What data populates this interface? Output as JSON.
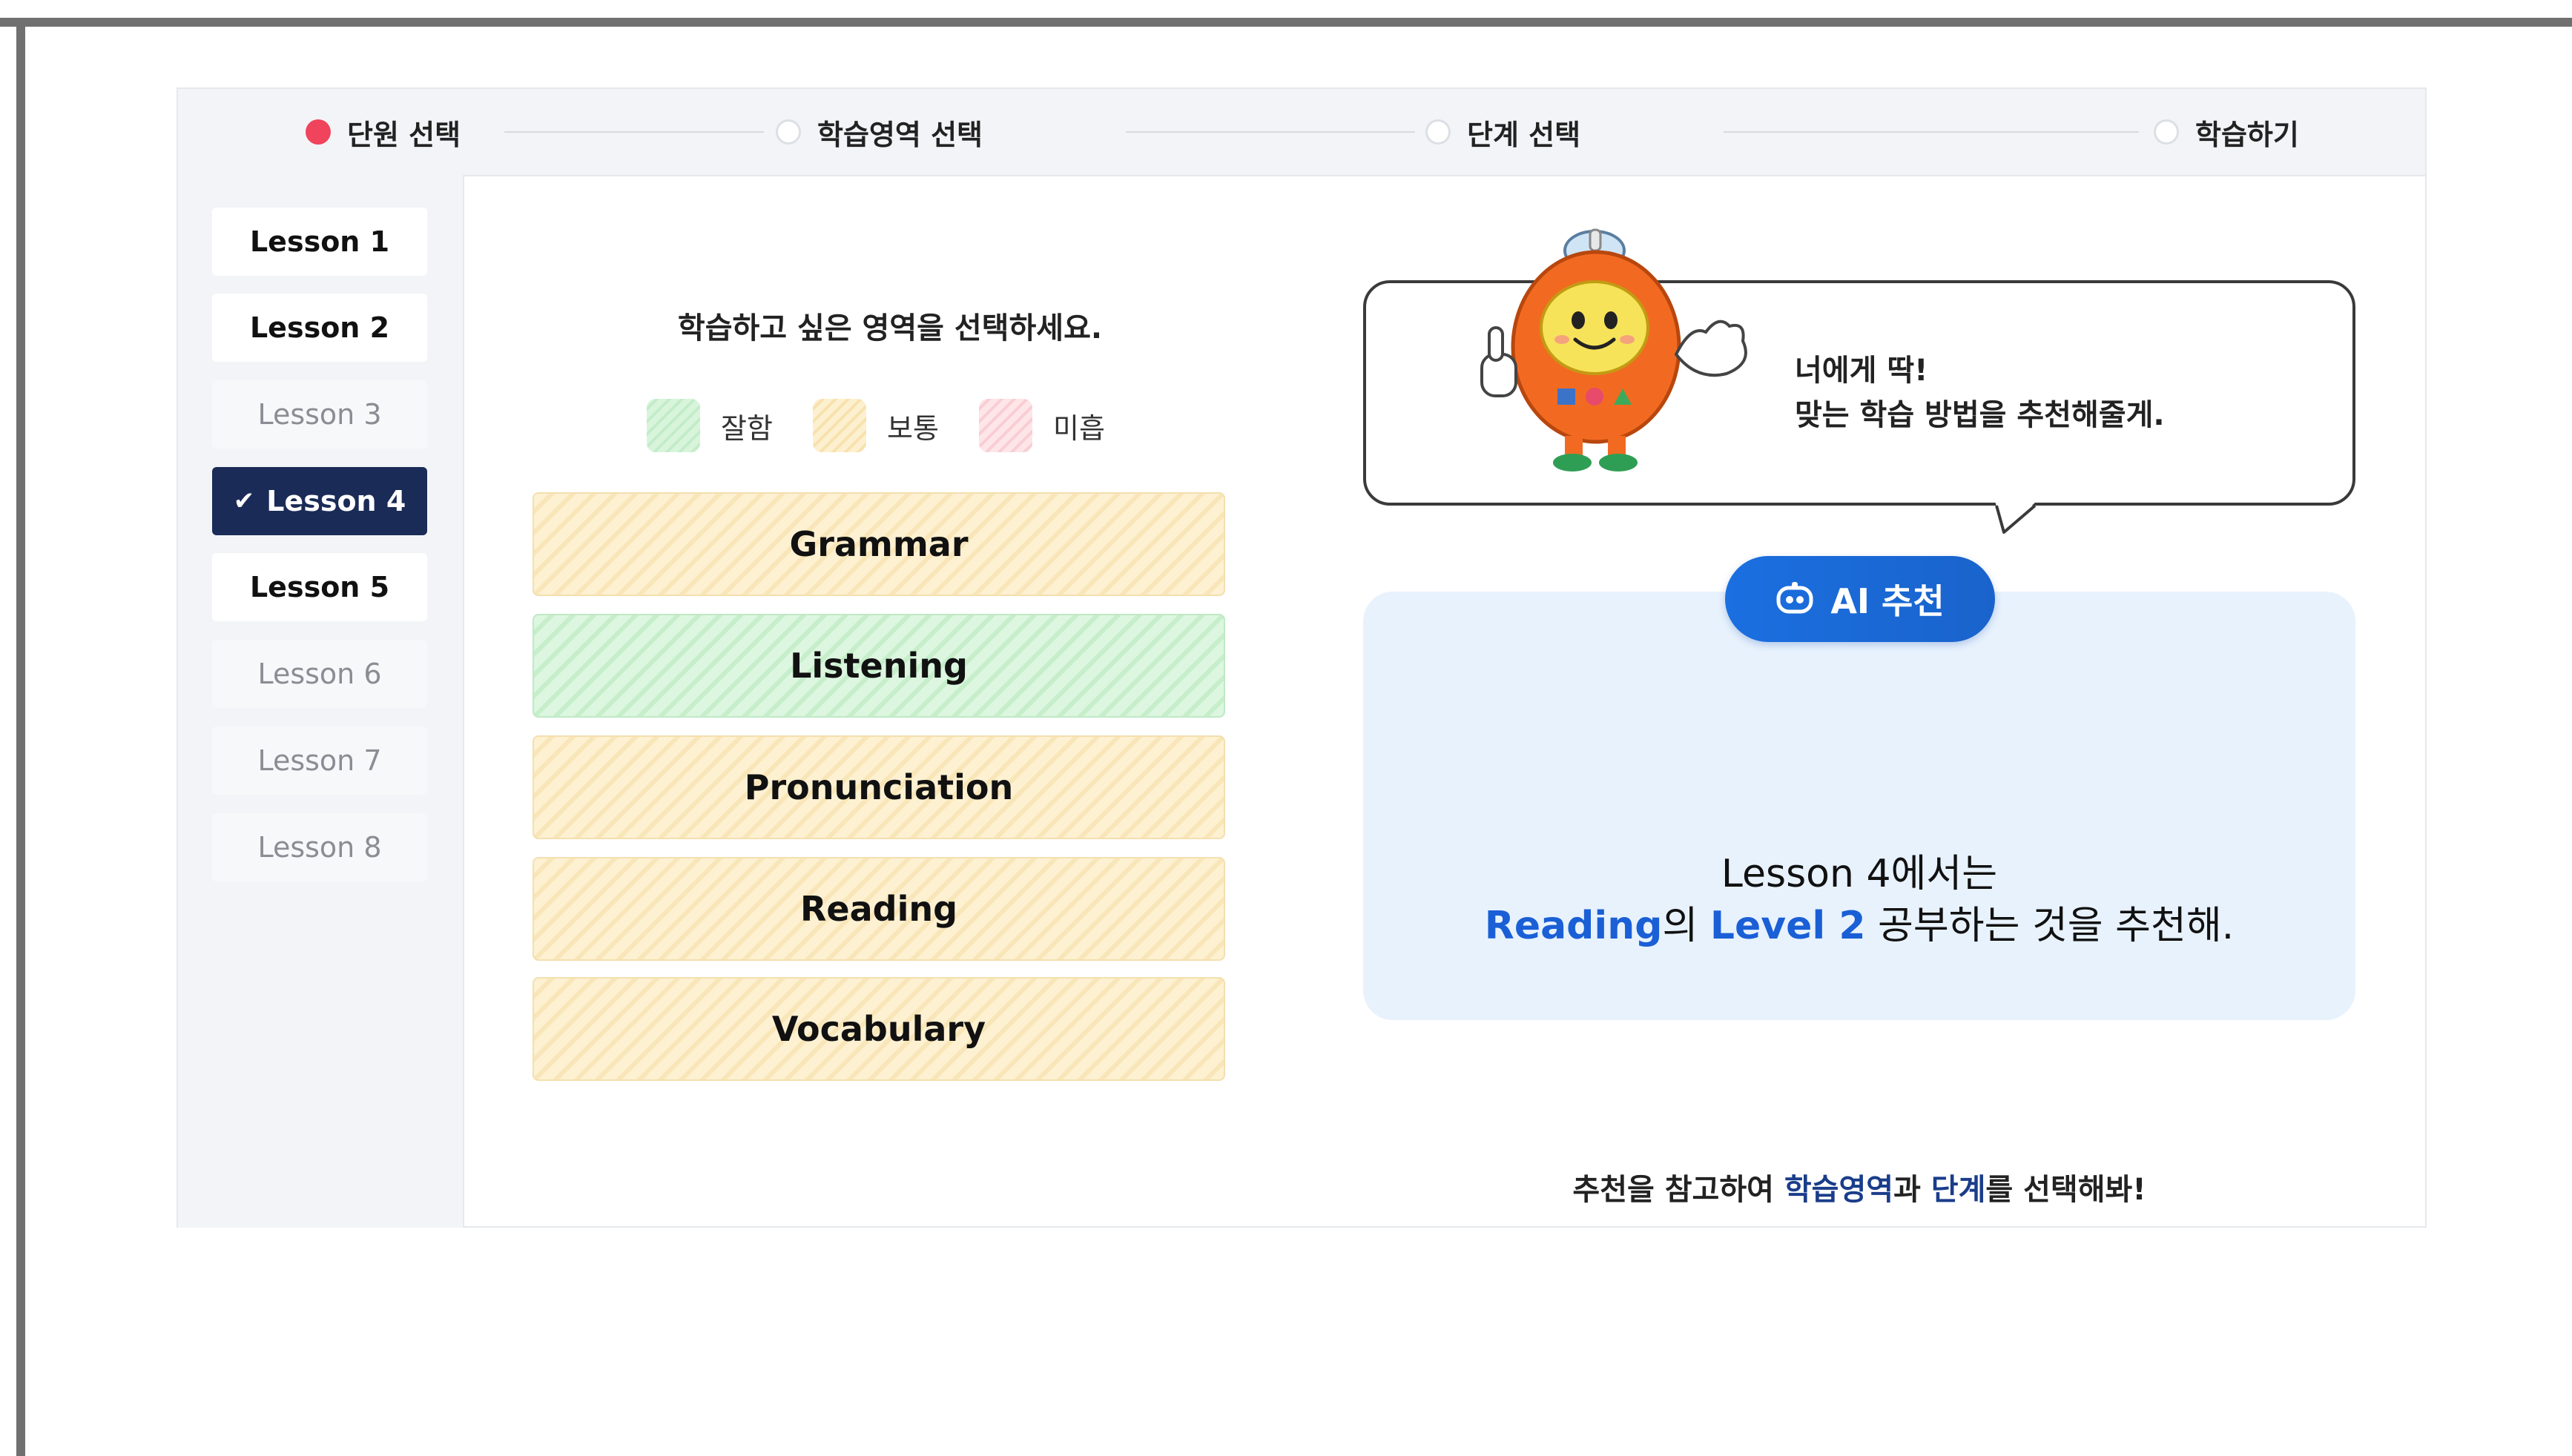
{
  "stepper": {
    "steps": [
      {
        "label": "단원 선택",
        "active": true
      },
      {
        "label": "학습영역 선택",
        "active": false
      },
      {
        "label": "단계 선택",
        "active": false
      },
      {
        "label": "학습하기",
        "active": false
      }
    ],
    "active_color": "#f0435c"
  },
  "sidebar": {
    "lessons": [
      {
        "label": "Lesson 1",
        "state": "available"
      },
      {
        "label": "Lesson 2",
        "state": "available"
      },
      {
        "label": "Lesson 3",
        "state": "disabled"
      },
      {
        "label": "Lesson 4",
        "state": "selected"
      },
      {
        "label": "Lesson 5",
        "state": "available"
      },
      {
        "label": "Lesson 6",
        "state": "disabled"
      },
      {
        "label": "Lesson 7",
        "state": "disabled"
      },
      {
        "label": "Lesson 8",
        "state": "disabled"
      }
    ],
    "selected_color": "#1a2b57",
    "check_icon": "check-icon"
  },
  "areas": {
    "prompt": "학습하고 싶은 영역을 선택하세요.",
    "legend": [
      {
        "label": "잘함",
        "color": "#c2ecc8"
      },
      {
        "label": "보통",
        "color": "#f7e1ad"
      },
      {
        "label": "미흡",
        "color": "#f8cdd3"
      }
    ],
    "items": [
      {
        "label": "Grammar",
        "level": "보통"
      },
      {
        "label": "Listening",
        "level": "잘함"
      },
      {
        "label": "Pronunciation",
        "level": "보통"
      },
      {
        "label": "Reading",
        "level": "보통"
      },
      {
        "label": "Vocabulary",
        "level": "보통"
      }
    ]
  },
  "mascot": {
    "icon": "mascot-character",
    "speech_line1": "너에게 딱!",
    "speech_line2": "맞는 학습 방법을 추천해줄게."
  },
  "recommendation": {
    "badge_label": "AI 추천",
    "badge_icon": "robot-icon",
    "line1": "Lesson 4에서는",
    "area": "Reading",
    "particle1": "의 ",
    "level": "Level 2",
    "line2_rest": " 공부하는 것을 추천해.",
    "highlight_color": "#1a5fd6"
  },
  "hint": {
    "prefix": "추천을 참고하여 ",
    "part1": "학습영역",
    "mid": "과 ",
    "part2": "단계",
    "suffix": "를 선택해봐!"
  }
}
